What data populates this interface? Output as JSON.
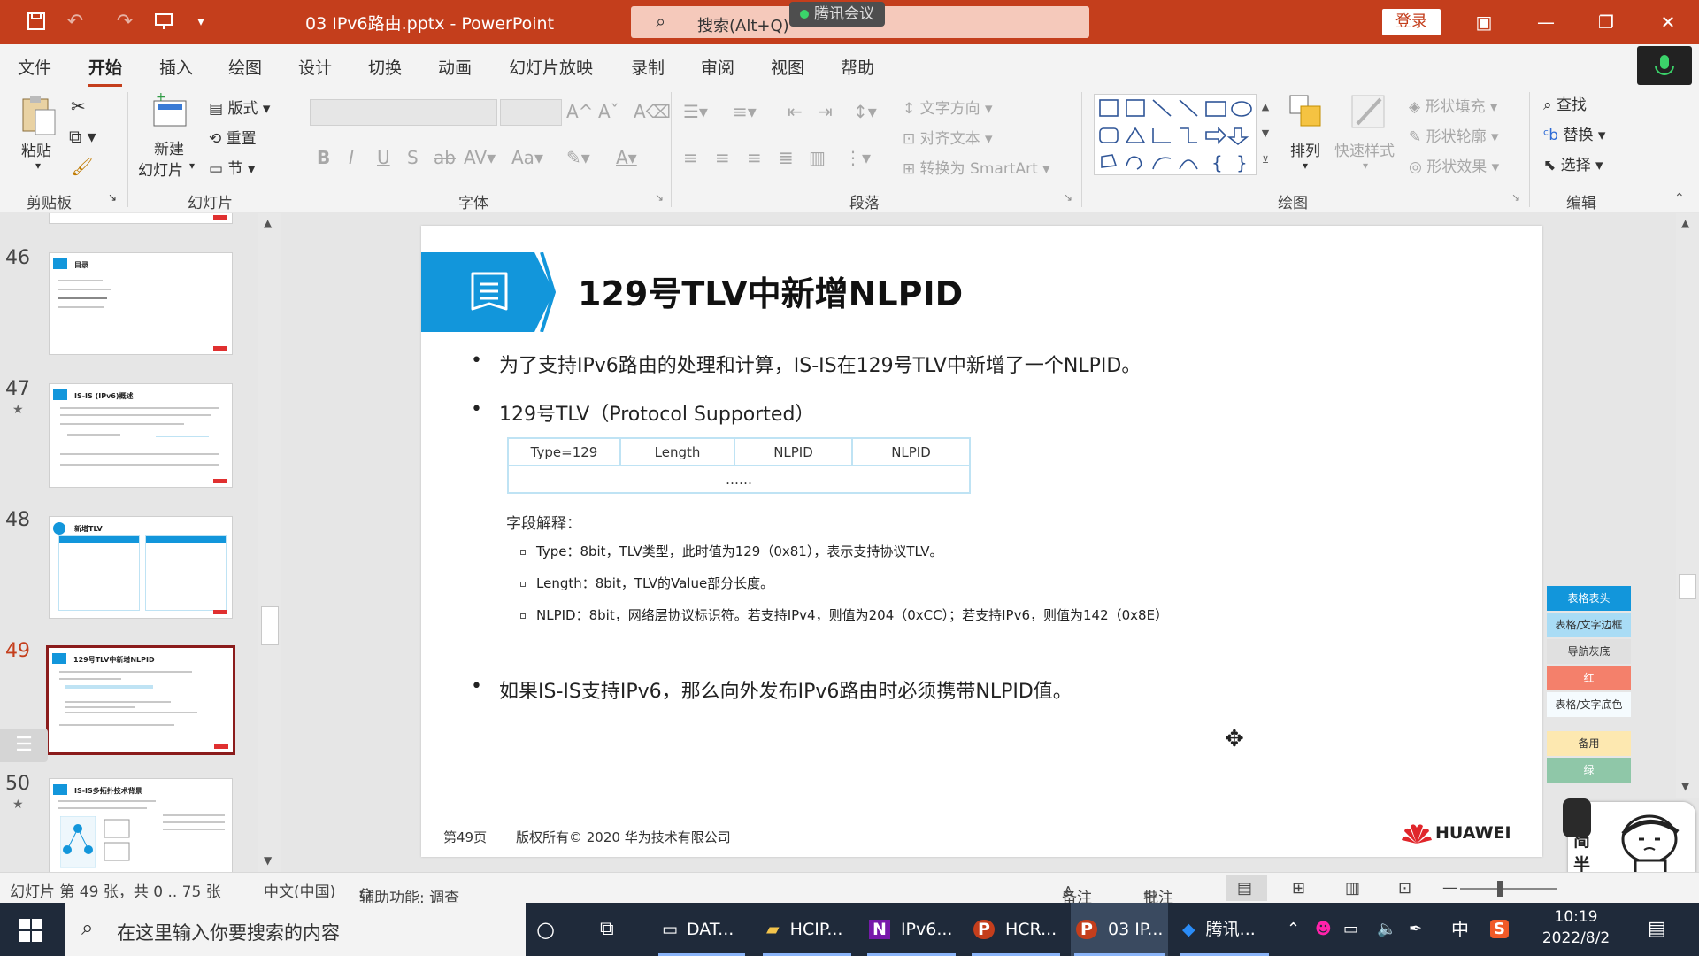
{
  "titlebar": {
    "doc_title": "03 IPv6路由.pptx  -  PowerPoint",
    "search_placeholder": "搜索(Alt+Q)",
    "meeting_pill": "腾讯会议",
    "login": "登录"
  },
  "tabs": [
    "文件",
    "开始",
    "插入",
    "绘图",
    "设计",
    "切换",
    "动画",
    "幻灯片放映",
    "录制",
    "审阅",
    "视图",
    "帮助"
  ],
  "ribbon": {
    "clipboard": {
      "paste": "粘贴",
      "label": "剪贴板"
    },
    "slides": {
      "new_slide_1": "新建",
      "new_slide_2": "幻灯片",
      "layout": "版式",
      "reset": "重置",
      "section": "节",
      "label": "幻灯片"
    },
    "font": {
      "label": "字体"
    },
    "paragraph": {
      "text_direction": "文字方向",
      "align_text": "对齐文本",
      "smartart": "转换为 SmartArt",
      "label": "段落"
    },
    "drawing": {
      "arrange": "排列",
      "quick_styles": "快速样式",
      "shape_fill": "形状填充",
      "shape_outline": "形状轮廓",
      "shape_effects": "形状效果",
      "label": "绘图"
    },
    "editing": {
      "find": "查找",
      "replace": "替换",
      "select": "选择",
      "label": "编辑"
    }
  },
  "thumbnails": [
    {
      "num": "46",
      "title": "目录"
    },
    {
      "num": "47",
      "title": "IS-IS (IPv6)概述"
    },
    {
      "num": "48",
      "title": "新增TLV"
    },
    {
      "num": "49",
      "title": "129号TLV中新增NLPID"
    },
    {
      "num": "50",
      "title": "IS-IS多拓扑技术背景"
    }
  ],
  "slide": {
    "title": "129号TLV中新增NLPID",
    "bullet1": "为了支持IPv6路由的处理和计算，IS-IS在129号TLV中新增了一个NLPID。",
    "bullet2": "129号TLV（Protocol Supported）",
    "table": {
      "row1": [
        "Type=129",
        "Length",
        "NLPID",
        "NLPID"
      ],
      "row2": "……"
    },
    "field_head": "字段解释：",
    "fields": [
      "Type：8bit，TLV类型，此时值为129（0x81），表示支持协议TLV。",
      "Length：8bit，TLV的Value部分长度。",
      "NLPID：8bit，网络层协议标识符。若支持IPv4，则值为204（0xCC）；若支持IPv6，则值为142（0x8E）"
    ],
    "bullet3": "如果IS-IS支持IPv6，那么向外发布IPv6路由时必须携带NLPID值。",
    "footer_page": "第49页",
    "footer_copy": "版权所有© 2020 华为技术有限公司",
    "logo": "HUAWEI"
  },
  "palette": [
    {
      "label": "表格表头",
      "bg": "#1296db",
      "fg": "#ffffff"
    },
    {
      "label": "表格/文字边框",
      "bg": "#a9dcf5",
      "fg": "#333333"
    },
    {
      "label": "导航灰底",
      "bg": "#e0e0e0",
      "fg": "#333333"
    },
    {
      "label": "红",
      "bg": "#f4806b",
      "fg": "#ffffff"
    },
    {
      "label": "表格/文字底色",
      "bg": "#f5fbfe",
      "fg": "#333333"
    },
    {
      "label": "备用",
      "bg": "#fde8b0",
      "fg": "#333333"
    },
    {
      "label": "绿",
      "bg": "#8fc7a8",
      "fg": "#ffffff"
    }
  ],
  "ime_chars": [
    "中",
    "简",
    "半"
  ],
  "statusbar": {
    "slide_info": "幻灯片 第 49 张，共 0 .. 75 张",
    "language": "中文(中国)",
    "accessibility": "辅助功能: 调查",
    "notes": "备注",
    "comments": "批注"
  },
  "taskbar": {
    "search_placeholder": "在这里输入你要搜索的内容",
    "apps": [
      "DAT...",
      "HCIP...",
      "IPv6...",
      "HCR...",
      "03 IP...",
      "腾讯..."
    ],
    "ime": "中",
    "time": "10:19",
    "date": "2022/8/2"
  },
  "colors": {
    "accent": "#c43e1c",
    "slide_blue": "#1296db",
    "selected_thumb": "#8b1c1c"
  }
}
